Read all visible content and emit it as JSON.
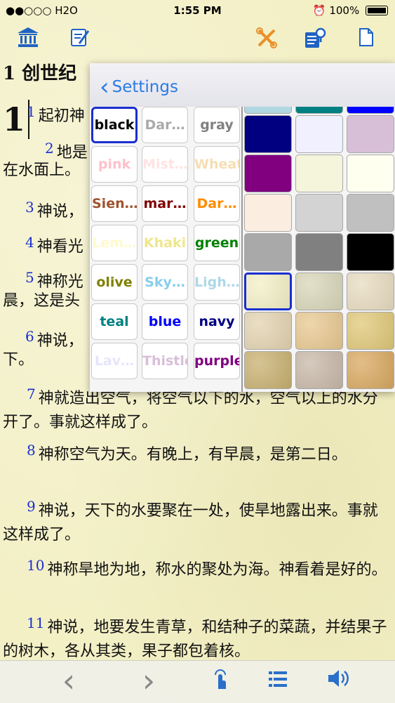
{
  "status": {
    "carrier": "●●○○○ H2O",
    "time": "1:55 PM",
    "battery": "100%",
    "wifi_icon": "wifi-icon",
    "alarm_icon": "alarm-icon"
  },
  "toolbar": {
    "items": [
      {
        "name": "library-icon",
        "glyph": "🏛"
      },
      {
        "name": "edit-note-icon",
        "glyph": "✎"
      },
      {
        "name": "tools-icon",
        "glyph": "✂"
      },
      {
        "name": "search-notes-icon",
        "glyph": "🔍"
      },
      {
        "name": "document-icon",
        "glyph": "📄"
      }
    ]
  },
  "reader": {
    "chapter_title": "1 创世纪",
    "big_number": "1",
    "verses": [
      {
        "num": "1",
        "text": "起初神"
      },
      {
        "num": "2",
        "text": "地是"
      },
      {
        "num": "",
        "text": "在水面上。"
      },
      {
        "num": "3",
        "text": "神说，"
      },
      {
        "num": "4",
        "text": "神看光"
      },
      {
        "num": "5",
        "text": "神称光"
      },
      {
        "num": "",
        "text": "晨，这是头"
      },
      {
        "num": "6",
        "text": "神说，"
      },
      {
        "num": "",
        "text": "下。"
      },
      {
        "num": "7",
        "text": "神就造出空气，将空气以下的水，空气以上的水分开了。事就这样成了。"
      },
      {
        "num": "8",
        "text": "神称空气为天。有晚上，有早晨，是第二日。"
      },
      {
        "num": "9",
        "text": "神说，天下的水要聚在一处，使旱地露出来。事就这样成了。"
      },
      {
        "num": "10",
        "text": "神称旱地为地，称水的聚处为海。神看着是好的。"
      },
      {
        "num": "11",
        "text": "神说，地要发生青草，和结种子的菜蔬，并结果子的树木，各从其类，果子都包着核。"
      }
    ]
  },
  "popover": {
    "back_label": "Settings",
    "text_colors": [
      [
        "black",
        "Dar…",
        "gray"
      ],
      [
        "pink",
        "Mist…",
        "Wheat"
      ],
      [
        "Sien…",
        "mar…",
        "Dar…"
      ],
      [
        "Lem…",
        "Khaki",
        "green"
      ],
      [
        "olive",
        "Sky…",
        "Ligh…"
      ],
      [
        "teal",
        "blue",
        "navy"
      ],
      [
        "Lav…",
        "Thistle",
        "purple"
      ]
    ],
    "text_colors_hex": [
      [
        "#000000",
        "#a9a9a9",
        "#808080"
      ],
      [
        "#ffc0cb",
        "#ffe4e1",
        "#f5deb3"
      ],
      [
        "#a0522d",
        "#800000",
        "#ff8c00"
      ],
      [
        "#fffacd",
        "#f0e68c",
        "#008000"
      ],
      [
        "#808000",
        "#87ceeb",
        "#add8e6"
      ],
      [
        "#008080",
        "#0000ff",
        "#000080"
      ],
      [
        "#e6e6fa",
        "#d8bfd8",
        "#800080"
      ]
    ],
    "selected_text_color": "black",
    "background_swatches": [
      [
        "#000080",
        "#f0f0ff",
        "#d8bfd8"
      ],
      [
        "#800080",
        "#f5f5dc",
        "#fffff0"
      ],
      [
        "#fbeee0",
        "#d3d3d3",
        "#c0c0c0"
      ],
      [
        "#a9a9a9",
        "#808080",
        "#000000"
      ],
      [
        "#f3f0c6",
        "#d8d6b8",
        "#e8dcc0"
      ],
      [
        "#e3d3b0",
        "#e8c890",
        "#e0c878"
      ],
      [
        "#c8b070",
        "#c8b8a8",
        "#d8a860"
      ]
    ],
    "top_partial_swatches": [
      "#b0d8e0",
      "#008080",
      "#0000ff"
    ]
  },
  "bottombar": {
    "items": [
      {
        "name": "previous-chapter-icon",
        "glyph": "‹"
      },
      {
        "name": "next-chapter-icon",
        "glyph": "›"
      },
      {
        "name": "tap-icon",
        "glyph": "☝"
      },
      {
        "name": "list-icon",
        "glyph": "☰"
      },
      {
        "name": "speaker-icon",
        "glyph": "🔊"
      }
    ]
  }
}
